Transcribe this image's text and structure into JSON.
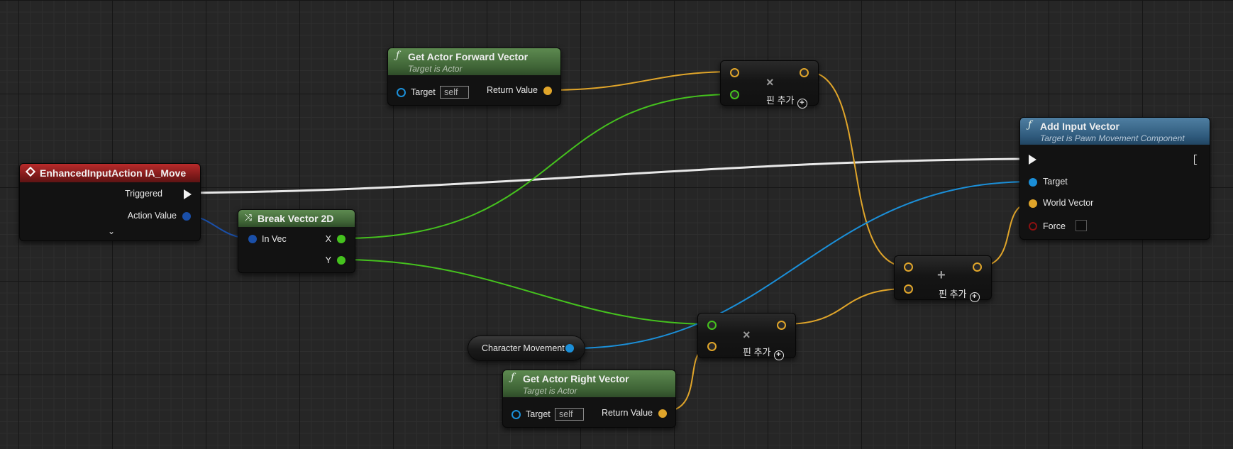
{
  "colors": {
    "exec_wire": "#e8e8e8",
    "vector_wire": "#e0a52a",
    "float_wire": "#45c21e",
    "object_wire": "#1b8fd8",
    "struct2d_wire": "#1a4fa8"
  },
  "nodes": {
    "event": {
      "title": "EnhancedInputAction IA_Move",
      "icon": "event-diamond-icon",
      "pins": {
        "triggered": "Triggered",
        "action_value": "Action Value"
      },
      "expand_icon": "chevron-down-icon"
    },
    "break_vector": {
      "title": "Break Vector 2D",
      "icon": "break-struct-icon",
      "pins": {
        "in_vec": "In Vec",
        "x": "X",
        "y": "Y"
      }
    },
    "forward_vector": {
      "title": "Get Actor Forward Vector",
      "subtitle": "Target is Actor",
      "fn_glyph": "ƒ",
      "pins": {
        "target": "Target",
        "target_value": "self",
        "return_value": "Return Value"
      }
    },
    "right_vector": {
      "title": "Get Actor Right Vector",
      "subtitle": "Target is Actor",
      "fn_glyph": "ƒ",
      "pins": {
        "target": "Target",
        "target_value": "self",
        "return_value": "Return Value"
      }
    },
    "multiply_top": {
      "operator": "×",
      "add_pin": "핀 추가"
    },
    "multiply_bottom": {
      "operator": "×",
      "add_pin": "핀 추가"
    },
    "add": {
      "operator": "+",
      "add_pin": "핀 추가"
    },
    "character_movement": {
      "label": "Character Movement"
    },
    "add_input_vector": {
      "title": "Add Input Vector",
      "subtitle": "Target is Pawn Movement Component",
      "fn_glyph": "ƒ",
      "pins": {
        "target": "Target",
        "world_vector": "World Vector",
        "force": "Force"
      },
      "force_checked": false
    }
  }
}
